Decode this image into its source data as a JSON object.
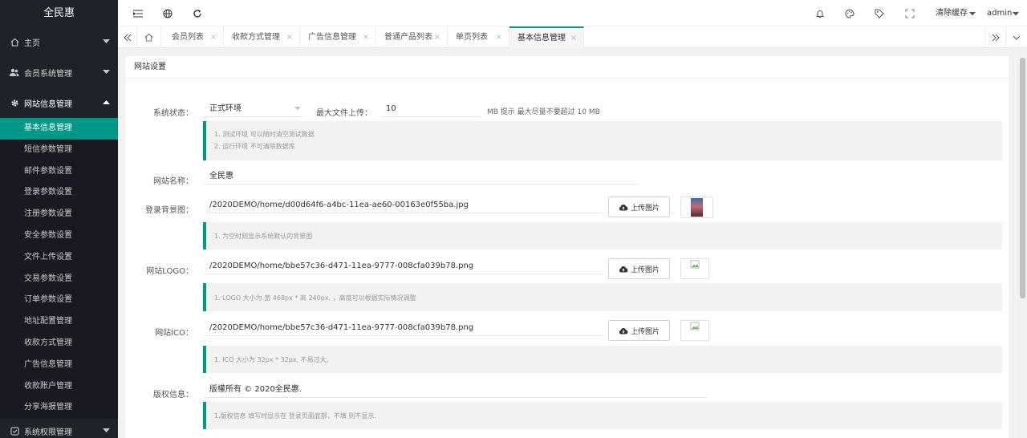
{
  "app": {
    "title": "全民惠"
  },
  "sidebar": {
    "home": "主页",
    "member": "会员系统管理",
    "site": "网站信息管理",
    "site_items": [
      "基本信息管理",
      "短信参数管理",
      "邮件参数设置",
      "登录参数设置",
      "注册参数设置",
      "安全参数设置",
      "文件上传设置",
      "交易参数设置",
      "订单参数设置",
      "地址配置管理",
      "收款方式管理",
      "广告信息管理",
      "收款账户管理",
      "分享海报管理"
    ],
    "permission": "系统权限管理"
  },
  "header": {
    "clear_cache": "清除缓存",
    "user": "admin"
  },
  "tabs": [
    {
      "label": "会员列表"
    },
    {
      "label": "收款方式管理"
    },
    {
      "label": "广告信息管理"
    },
    {
      "label": "普通产品列表"
    },
    {
      "label": "单页列表"
    },
    {
      "label": "基本信息管理"
    }
  ],
  "tab_close": "×",
  "form": {
    "section_title": "网站设置",
    "status_label": "系统状态：",
    "status_value": "正式环境",
    "max_upload_label": "最大文件上传：",
    "max_upload_value": "10",
    "max_upload_suffix": "MB 提示 最大尽量不要超过 10 MB",
    "status_hints": [
      "1. 测试环境 可以随时清空测试数据",
      "2. 运行环境 不可清除数据库"
    ],
    "site_name_label": "网站名称：",
    "site_name_value": "全民惠",
    "bg_label": "登录背景图：",
    "bg_value": "/2020DEMO/home/d00d64f6-a4bc-11ea-ae60-00163e0f55ba.jpg",
    "bg_hint": "1. 为空时则显示系统默认的背景图",
    "logo_label": "网站LOGO：",
    "logo_value": "/2020DEMO/home/bbe57c36-d471-11ea-9777-008cfa039b78.png",
    "logo_hint": "1. LOGO 大小为 宽 468px * 高 240px, ，高度可以根据实际情况调整",
    "ico_label": "网站ICO：",
    "ico_value": "/2020DEMO/home/bbe57c36-d471-11ea-9777-008cfa039b78.png",
    "ico_hint": "1. ICO 大小为 32px * 32px, 不易过大,",
    "copyright_label": "版权信息：",
    "copyright_value": "版權所有 © 2020全民惠.",
    "copyright_hint": "1.版权信息 填写时显示在 登录页面底部，不填 则不显示.",
    "upload_label": "上传图片"
  },
  "colors": {
    "accent": "#009688",
    "sidebar_bg": "#20222a"
  }
}
